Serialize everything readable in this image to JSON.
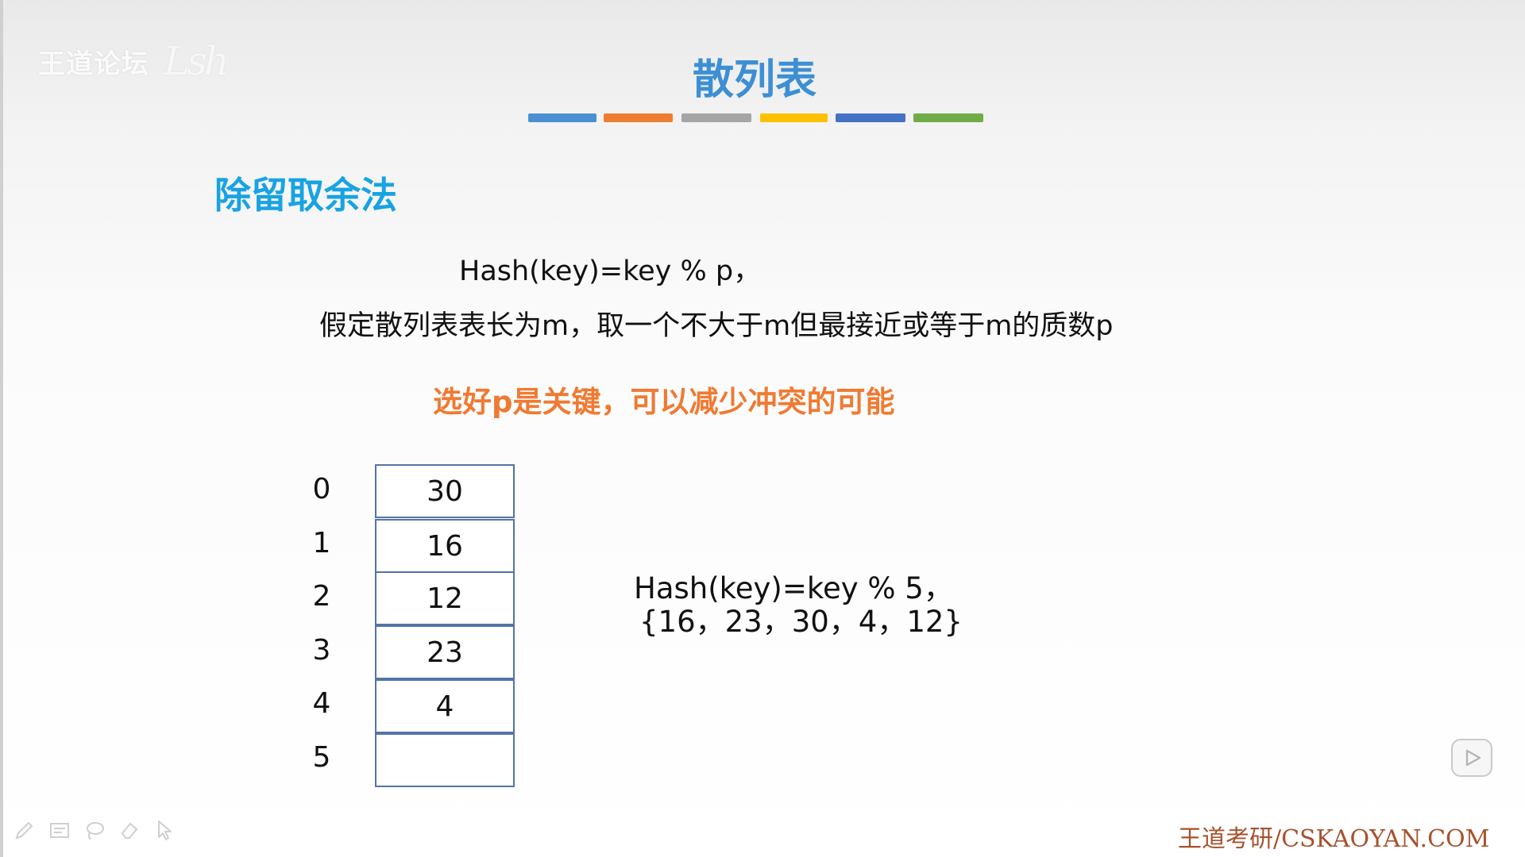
{
  "watermark": {
    "text": "王道论坛",
    "signature": "Lsh"
  },
  "slide": {
    "title": "散列表",
    "color_bars": [
      "#4a90d0",
      "#ed7d31",
      "#a5a5a5",
      "#ffc000",
      "#4472c4",
      "#70ad47"
    ],
    "section_title": "除留取余法",
    "formula": "Hash(key)=key % p，",
    "description": "假定散列表表长为m，取一个不大于m但最接近或等于m的质数p",
    "highlight": "选好p是关键，可以减少冲突的可能",
    "highlight_color": "#f07a32"
  },
  "hash_table": {
    "rows": [
      {
        "index": "0",
        "value": "30"
      },
      {
        "index": "1",
        "value": "16"
      },
      {
        "index": "2",
        "value": "12"
      },
      {
        "index": "3",
        "value": "23"
      },
      {
        "index": "4",
        "value": "4"
      },
      {
        "index": "5",
        "value": ""
      }
    ]
  },
  "example": {
    "formula": "Hash(key)=key % 5，",
    "keys": "{16，23，30，4，12}"
  },
  "footer": {
    "text": "王道考研/CSKAOYAN.COM"
  },
  "controls": {
    "play_icon": "play-icon",
    "tools": [
      "pen-icon",
      "board-icon",
      "lasso-icon",
      "eraser-icon",
      "pointer-icon"
    ]
  }
}
